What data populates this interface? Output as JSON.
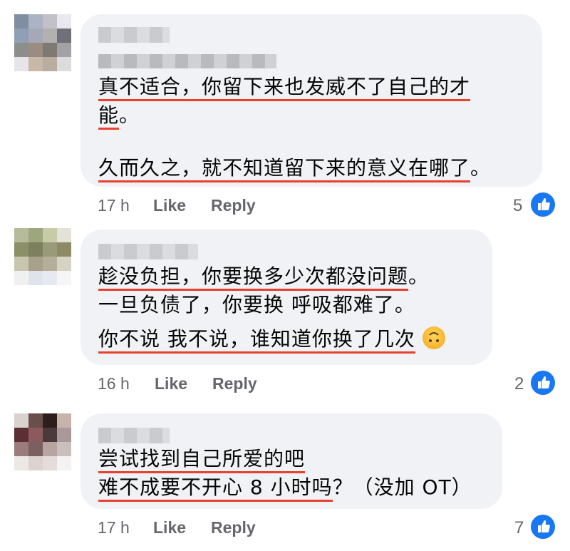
{
  "comments": [
    {
      "lines": [
        {
          "segments": [
            {
              "text": "真不适合，你留下来也发威不了自己的才",
              "underline": true
            }
          ]
        },
        {
          "segments": [
            {
              "text": "能",
              "underline": true
            },
            {
              "text": "。",
              "underline": false
            }
          ]
        },
        {
          "segments": [
            {
              "text": "",
              "underline": false
            }
          ]
        },
        {
          "segments": [
            {
              "text": "久而久之，就不知道留下来的意义在哪了",
              "underline": true
            },
            {
              "text": "。",
              "underline": false
            }
          ]
        }
      ],
      "time": "17 h",
      "like_label": "Like",
      "reply_label": "Reply",
      "like_count": "5"
    },
    {
      "lines": [
        {
          "segments": [
            {
              "text": "趁没负担，你要换多少次都没问题",
              "underline": true
            },
            {
              "text": "。",
              "underline": false
            }
          ]
        },
        {
          "segments": [
            {
              "text": "一旦负债了，你要换 呼吸都难了。",
              "underline": false
            }
          ]
        },
        {
          "segments": [
            {
              "text": "你不说 我不说，谁知道你换了几次",
              "underline": true
            }
          ]
        }
      ],
      "time": "16 h",
      "like_label": "Like",
      "reply_label": "Reply",
      "like_count": "2"
    },
    {
      "lines": [
        {
          "segments": [
            {
              "text": "尝试找到自己所爱的吧",
              "underline": true
            }
          ]
        },
        {
          "segments": [
            {
              "text": "难不成要不开心 8 小时吗",
              "underline": true
            },
            {
              "text": "？（没加 OT）",
              "underline": false
            }
          ]
        }
      ],
      "time": "17 h",
      "like_label": "Like",
      "reply_label": "Reply",
      "like_count": "7"
    }
  ],
  "colors": {
    "bubble": "#f0f2f5",
    "underline": "#e8412e",
    "meta_text": "#65676b",
    "like_icon": "#1877f2"
  },
  "icons": {
    "reaction": "thumbs-up-icon",
    "emoji": "upside-down-face-emoji"
  }
}
